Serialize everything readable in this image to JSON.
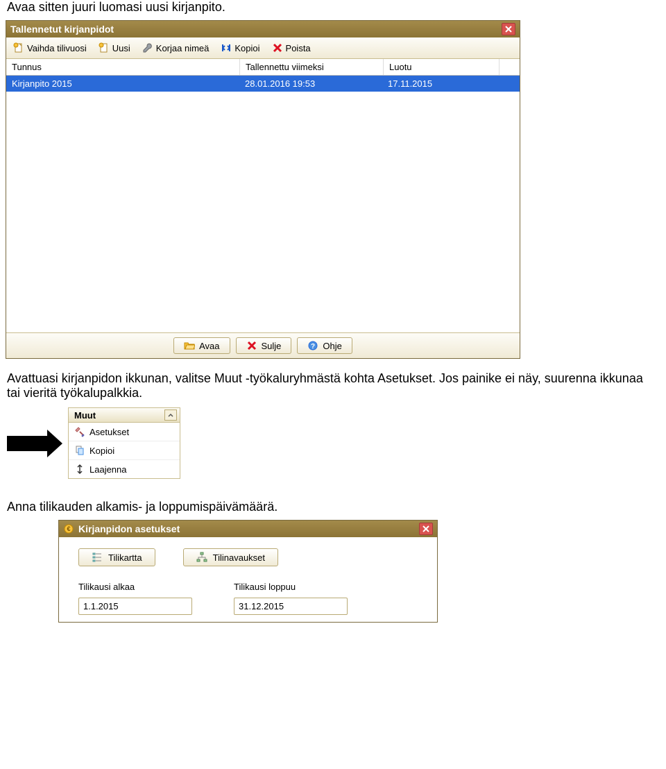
{
  "para1": "Avaa sitten juuri luomasi uusi kirjanpito.",
  "para2": "Avattuasi kirjanpidon ikkunan, valitse Muut -työkaluryhmästä kohta Asetukset. Jos painike ei näy, suurenna ikkunaa tai vieritä työkalupalkkia.",
  "para3": "Anna tilikauden alkamis- ja loppumispäivämäärä.",
  "dialog1": {
    "title": "Tallennetut kirjanpidot",
    "toolbar": {
      "vaihda": "Vaihda tilivuosi",
      "uusi": "Uusi",
      "korjaa": "Korjaa nimeä",
      "kopioi": "Kopioi",
      "poista": "Poista"
    },
    "columns": {
      "tunnus": "Tunnus",
      "tallennettu": "Tallennettu viimeksi",
      "luotu": "Luotu"
    },
    "row": {
      "tunnus": "Kirjanpito 2015",
      "tallennettu": "28.01.2016   19:53",
      "luotu": "17.11.2015"
    },
    "footer": {
      "avaa": "Avaa",
      "sulje": "Sulje",
      "ohje": "Ohje"
    }
  },
  "muut": {
    "title": "Muut",
    "items": {
      "asetukset": "Asetukset",
      "kopioi": "Kopioi",
      "laajenna": "Laajenna"
    }
  },
  "dialog2": {
    "title": "Kirjanpidon asetukset",
    "buttons": {
      "tilikartta": "Tilikartta",
      "tilinavaukset": "Tilinavaukset"
    },
    "fields": {
      "alkaa_label": "Tilikausi alkaa",
      "alkaa_value": "1.1.2015",
      "loppuu_label": "Tilikausi loppuu",
      "loppuu_value": "31.12.2015"
    }
  }
}
